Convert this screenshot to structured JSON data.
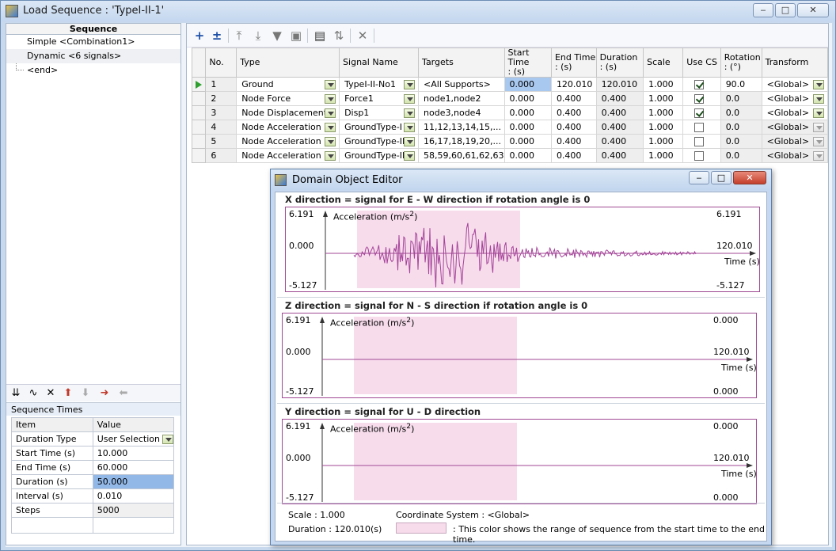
{
  "window": {
    "title": "Load Sequence : 'TypeI-II-1'",
    "controls": {
      "minimize": "‒",
      "maximize": "□",
      "close": "✕"
    }
  },
  "sequence": {
    "header": "Sequence",
    "items": [
      {
        "label": "Simple <Combination1>"
      },
      {
        "label": "Dynamic <6 signals>"
      },
      {
        "label": "<end>"
      }
    ]
  },
  "sequence_times": {
    "title": "Sequence Times",
    "columns": [
      "Item",
      "Value"
    ],
    "rows": [
      {
        "item": "Duration Type",
        "value": "User Selection"
      },
      {
        "item": "Start Time  (s)",
        "value": "10.000"
      },
      {
        "item": "End Time   (s)",
        "value": "60.000"
      },
      {
        "item": "Duration    (s)",
        "value": "50.000"
      },
      {
        "item": "Interval     (s)",
        "value": "0.010"
      },
      {
        "item": "Steps",
        "value": "5000"
      }
    ]
  },
  "signal_table": {
    "columns": {
      "no": "No.",
      "type": "Type",
      "signal": "Signal Name",
      "targets": "Targets",
      "start_1": "Start Time",
      "start_2": ": (s)",
      "end_1": "End Time",
      "end_2": ": (s)",
      "dur_1": "Duration",
      "dur_2": ": (s)",
      "scale": "Scale",
      "usecs": "Use CS",
      "rot_1": "Rotation",
      "rot_2": ": (°)",
      "transform": "Transform"
    },
    "rows": [
      {
        "no": "1",
        "type": "Ground",
        "signal": "TypeI-II-No1",
        "targets": "<All Supports>",
        "start": "0.000",
        "end": "120.010",
        "duration": "120.010",
        "scale": "1.000",
        "use_cs": true,
        "rotation": "90.0",
        "transform": "<Global>"
      },
      {
        "no": "2",
        "type": "Node Force",
        "signal": "Force1",
        "targets": "node1,node2",
        "start": "0.000",
        "end": "0.400",
        "duration": "0.400",
        "scale": "1.000",
        "use_cs": true,
        "rotation": "0.0",
        "transform": "<Global>"
      },
      {
        "no": "3",
        "type": "Node Displacement",
        "signal": "Disp1",
        "targets": "node3,node4",
        "start": "0.000",
        "end": "0.400",
        "duration": "0.400",
        "scale": "1.000",
        "use_cs": true,
        "rotation": "0.0",
        "transform": "<Global>"
      },
      {
        "no": "4",
        "type": "Node Acceleration",
        "signal": "GroundType-I",
        "targets": "11,12,13,14,15,...",
        "start": "0.000",
        "end": "0.400",
        "duration": "0.400",
        "scale": "1.000",
        "use_cs": false,
        "rotation": "0.0",
        "transform": "<Global>"
      },
      {
        "no": "5",
        "type": "Node Acceleration",
        "signal": "GroundType-II",
        "targets": "16,17,18,19,20,...",
        "start": "0.000",
        "end": "0.400",
        "duration": "0.400",
        "scale": "1.000",
        "use_cs": false,
        "rotation": "0.0",
        "transform": "<Global>"
      },
      {
        "no": "6",
        "type": "Node Acceleration",
        "signal": "GroundType-III",
        "targets": "58,59,60,61,62,63",
        "start": "0.000",
        "end": "0.400",
        "duration": "0.400",
        "scale": "1.000",
        "use_cs": false,
        "rotation": "0.0",
        "transform": "<Global>"
      }
    ]
  },
  "dialog": {
    "title": "Domain Object Editor",
    "sections": [
      {
        "title": "X direction = signal for E - W direction if rotation angle is 0",
        "ymax": "6.191",
        "yzero": "0.000",
        "ymin": "-5.127",
        "ylabel": "Acceleration (m/s",
        "ylabel_sup": "2",
        "ylabel_end": ")",
        "right_max": "6.191",
        "right_end": "120.010",
        "right_min": "-5.127",
        "xlabel": "Time (s)",
        "has_signal": true
      },
      {
        "title": "Z direction = signal for N - S direction if rotation angle is 0",
        "ymax": "6.191",
        "yzero": "0.000",
        "ymin": "-5.127",
        "ylabel": "Acceleration (m/s",
        "ylabel_sup": "2",
        "ylabel_end": ")",
        "right_max": "0.000",
        "right_end": "120.010",
        "right_min": "0.000",
        "xlabel": "Time (s)",
        "has_signal": false
      },
      {
        "title": "Y direction = signal for U - D direction",
        "ymax": "6.191",
        "yzero": "0.000",
        "ymin": "-5.127",
        "ylabel": "Acceleration (m/s",
        "ylabel_sup": "2",
        "ylabel_end": ")",
        "right_max": "0.000",
        "right_end": "120.010",
        "right_min": "0.000",
        "xlabel": "Time (s)",
        "has_signal": false
      }
    ],
    "footer": {
      "scale": "Scale : 1.000",
      "duration": "Duration : 120.010(s)",
      "coord": "Coordinate System : <Global>",
      "legend": ": This color shows the range of sequence from the start time to the end time."
    },
    "colors": {
      "signal": "#a5449a",
      "range": "#f7dcec",
      "frame": "#a04a94"
    }
  }
}
